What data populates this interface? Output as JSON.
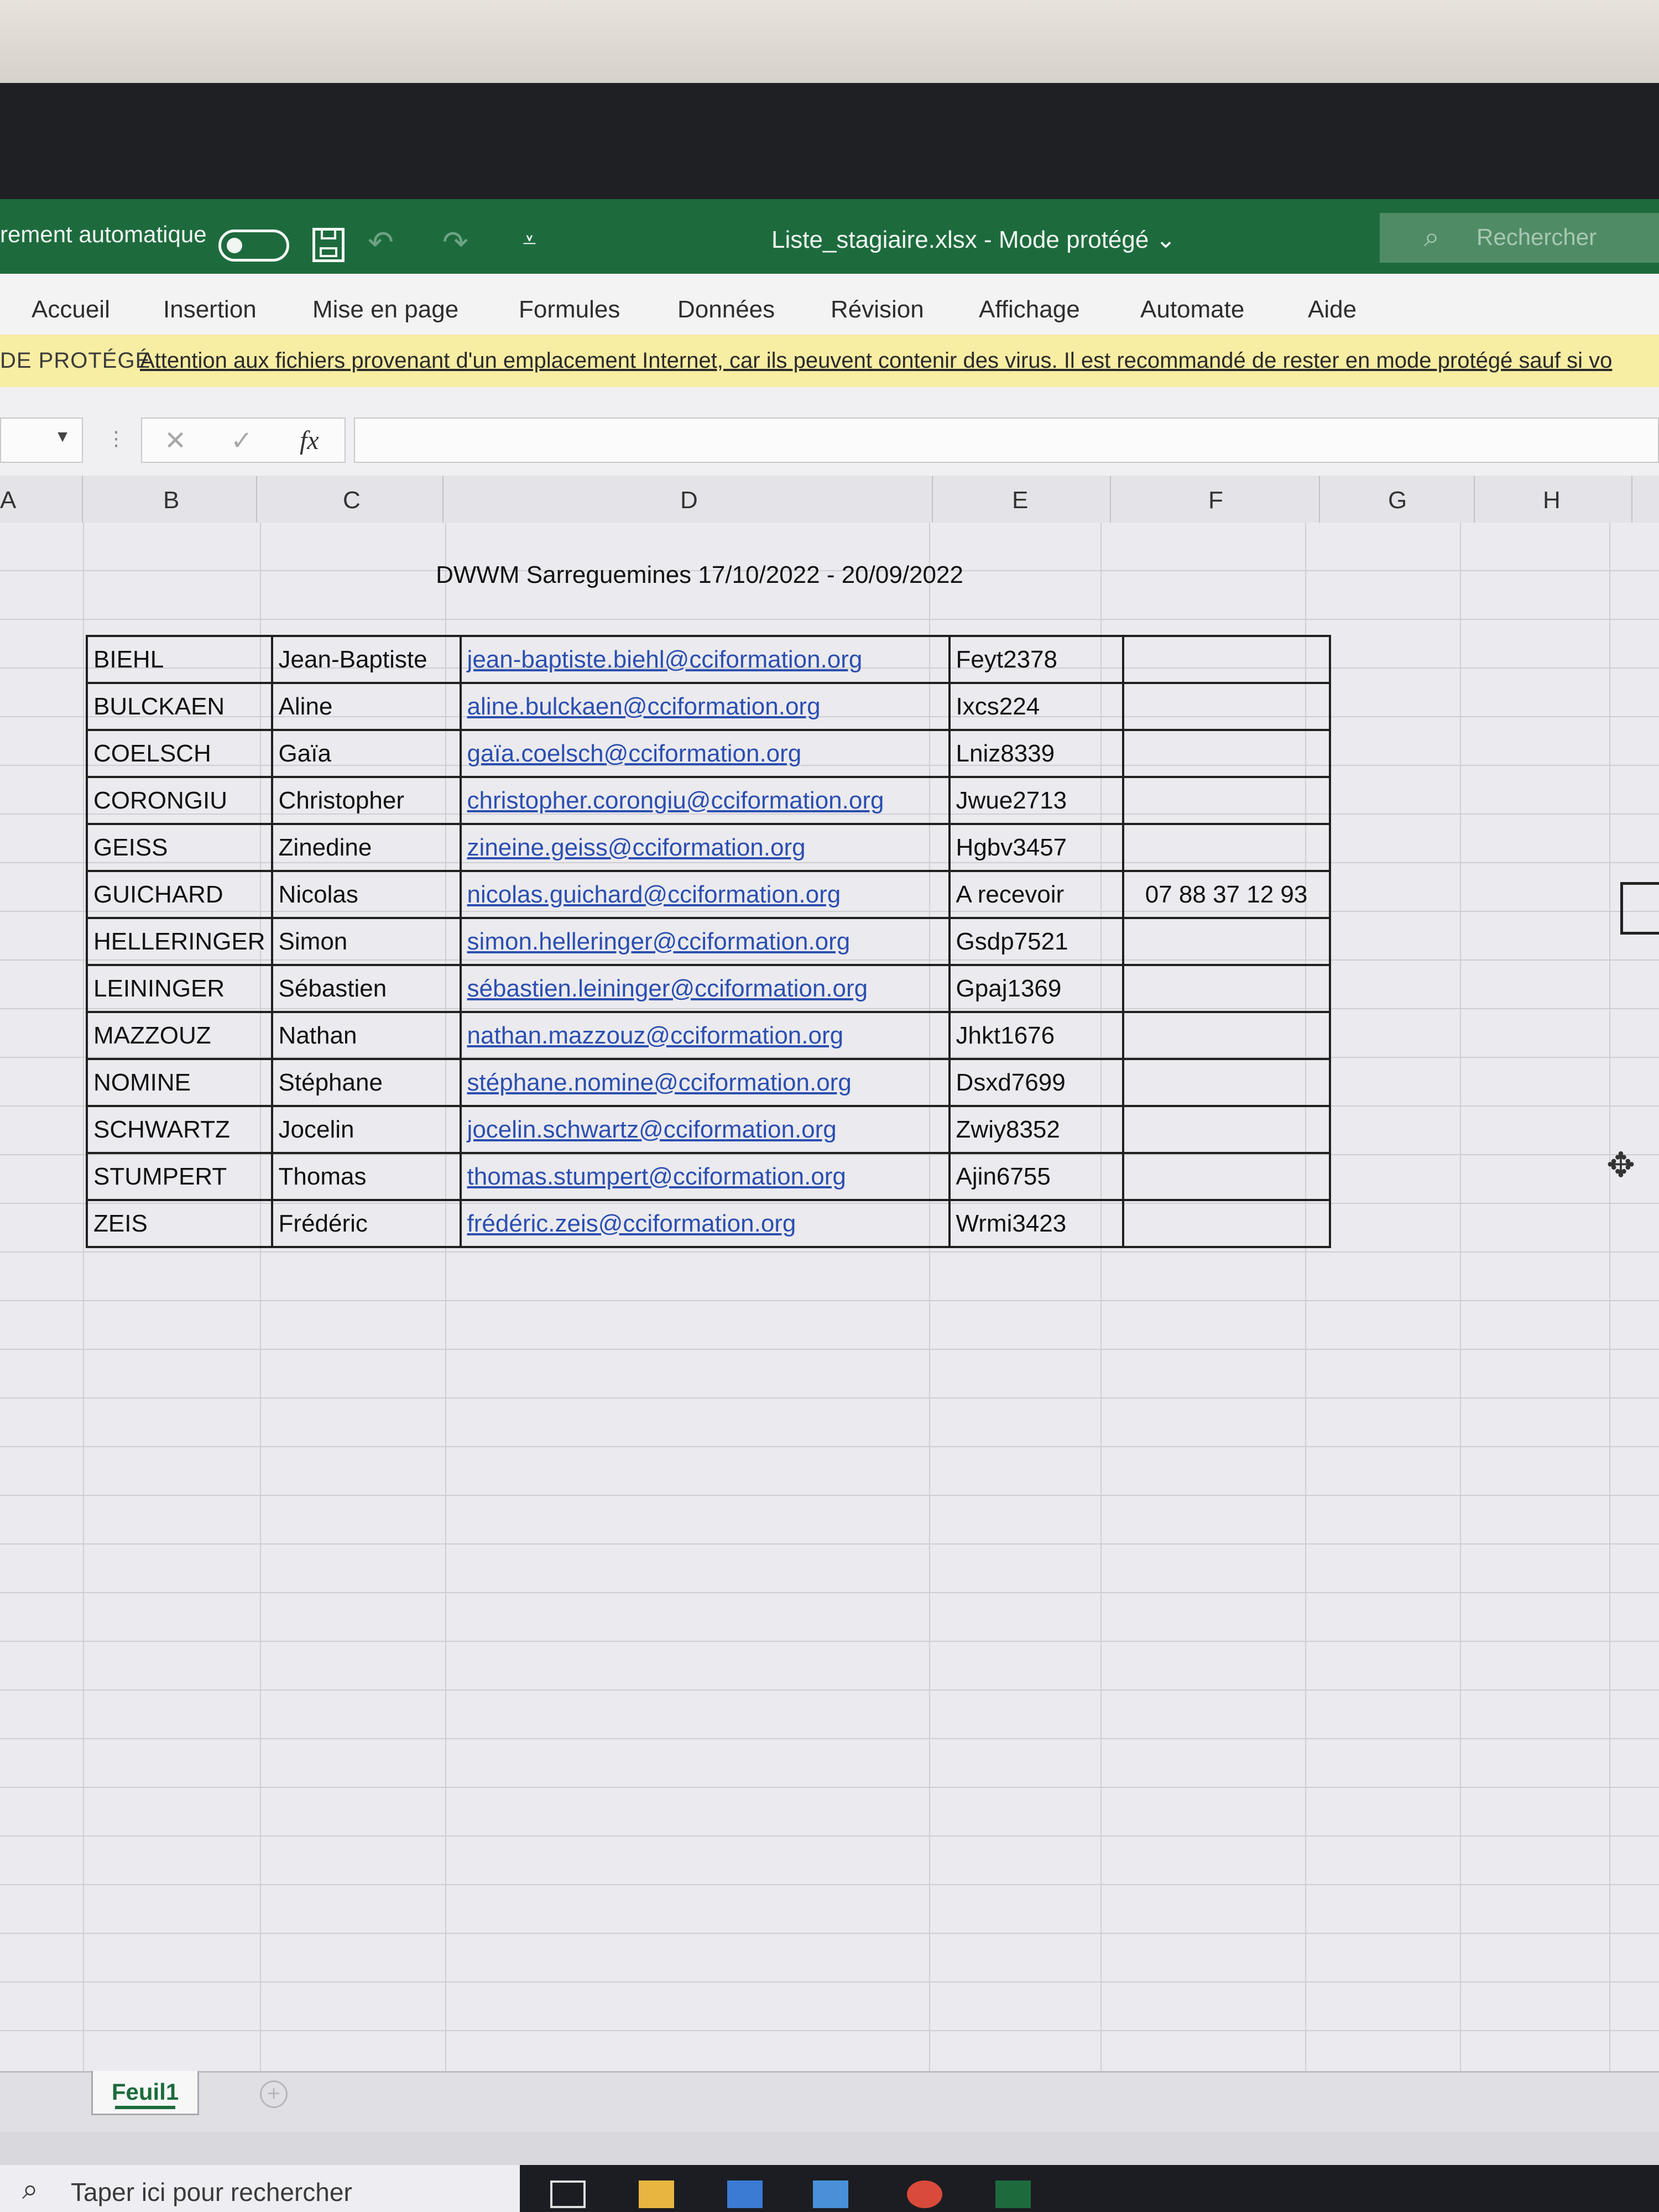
{
  "titlebar": {
    "autosave_label": "rement automatique",
    "file_title": "Liste_stagiaire.xlsx  -  Mode protégé",
    "title_chevron": "⌄",
    "search_placeholder": "Rechercher"
  },
  "ribbon_tabs": [
    "Accueil",
    "Insertion",
    "Mise en page",
    "Formules",
    "Données",
    "Révision",
    "Affichage",
    "Automate",
    "Aide"
  ],
  "protected_view": {
    "label": "DE PROTÉGÉ",
    "message": "Attention aux fichiers provenant d'un emplacement Internet, car ils peuvent contenir des virus. Il est recommandé de rester en mode protégé sauf si vo"
  },
  "formula_bar": {
    "fx_label": "fx",
    "cancel": "✕",
    "enter": "✓"
  },
  "columns": [
    "A",
    "B",
    "C",
    "D",
    "E",
    "F",
    "G",
    "H"
  ],
  "sheet": {
    "banner": "DWWM Sarreguemines 17/10/2022 - 20/09/2022",
    "rows": [
      [
        "BIEHL",
        "Jean-Baptiste",
        "jean-baptiste.biehl@cciformation.org",
        "Feyt2378",
        ""
      ],
      [
        "BULCKAEN",
        "Aline",
        "aline.bulckaen@cciformation.org",
        "Ixcs224",
        ""
      ],
      [
        "COELSCH",
        "Gaïa",
        "gaïa.coelsch@cciformation.org",
        "Lniz8339",
        ""
      ],
      [
        "CORONGIU",
        "Christopher",
        "christopher.corongiu@cciformation.org",
        "Jwue2713",
        ""
      ],
      [
        "GEISS",
        "Zinedine",
        "zineine.geiss@cciformation.org",
        "Hgbv3457",
        ""
      ],
      [
        "GUICHARD",
        "Nicolas",
        "nicolas.guichard@cciformation.org",
        "A recevoir",
        "07 88 37 12 93"
      ],
      [
        "HELLERINGER",
        "Simon",
        "simon.helleringer@cciformation.org",
        "Gsdp7521",
        ""
      ],
      [
        "LEININGER",
        "Sébastien",
        "sébastien.leininger@cciformation.org",
        "Gpaj1369",
        ""
      ],
      [
        "MAZZOUZ",
        "Nathan",
        "nathan.mazzouz@cciformation.org",
        "Jhkt1676",
        ""
      ],
      [
        "NOMINE",
        "Stéphane",
        "stéphane.nomine@cciformation.org",
        "Dsxd7699",
        ""
      ],
      [
        "SCHWARTZ",
        "Jocelin",
        "jocelin.schwartz@cciformation.org",
        "Zwiy8352",
        ""
      ],
      [
        "STUMPERT",
        "Thomas",
        "thomas.stumpert@cciformation.org",
        "Ajin6755",
        ""
      ],
      [
        "ZEIS",
        "Frédéric",
        "frédéric.zeis@cciformation.org",
        "Wrmi3423",
        ""
      ]
    ]
  },
  "sheet_tabs": {
    "active": "Feuil1",
    "add": "+"
  },
  "taskbar": {
    "search_placeholder": "Taper ici pour rechercher"
  },
  "colors": {
    "excel_green": "#1d6b3d",
    "hyperlink": "#2b4fb0",
    "warning_bar": "#f7eda3"
  }
}
